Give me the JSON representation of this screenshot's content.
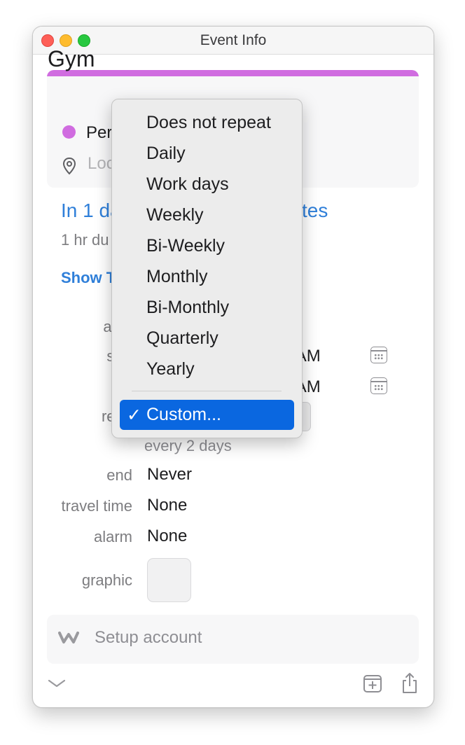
{
  "window": {
    "title": "Event Info"
  },
  "event": {
    "title": "Gym",
    "calendar": "Per",
    "location_placeholder": "Loc",
    "when_left": "In 1 da",
    "when_right": "tes",
    "duration": "1 hr du",
    "show_timezone": "Show T"
  },
  "fields": {
    "allday_label": "all-d",
    "start_label": "star",
    "start_value": "0 AM",
    "end_label": "en",
    "end_value": "0 AM",
    "repeat_label": "repe",
    "repeat_detail": "every 2 days",
    "repeat_end_label": "end",
    "repeat_end_value": "Never",
    "travel_label": "travel time",
    "travel_value": "None",
    "alarm_label": "alarm",
    "alarm_value": "None",
    "graphic_label": "graphic"
  },
  "account": {
    "setup_label": "Setup account"
  },
  "repeat_menu": {
    "items": [
      "Does not repeat",
      "Daily",
      "Work days",
      "Weekly",
      "Bi-Weekly",
      "Monthly",
      "Bi-Monthly",
      "Quarterly",
      "Yearly"
    ],
    "selected_check": "✓",
    "selected": "Custom..."
  },
  "colors": {
    "calendar_color": "#d06ce0",
    "accent_blue": "#2f7fd9",
    "menu_selection": "#0a67e0"
  },
  "icons": [
    "location-pin-icon",
    "calendar-icon",
    "webex-icon",
    "chevron-down-icon",
    "add-event-icon",
    "share-icon"
  ]
}
